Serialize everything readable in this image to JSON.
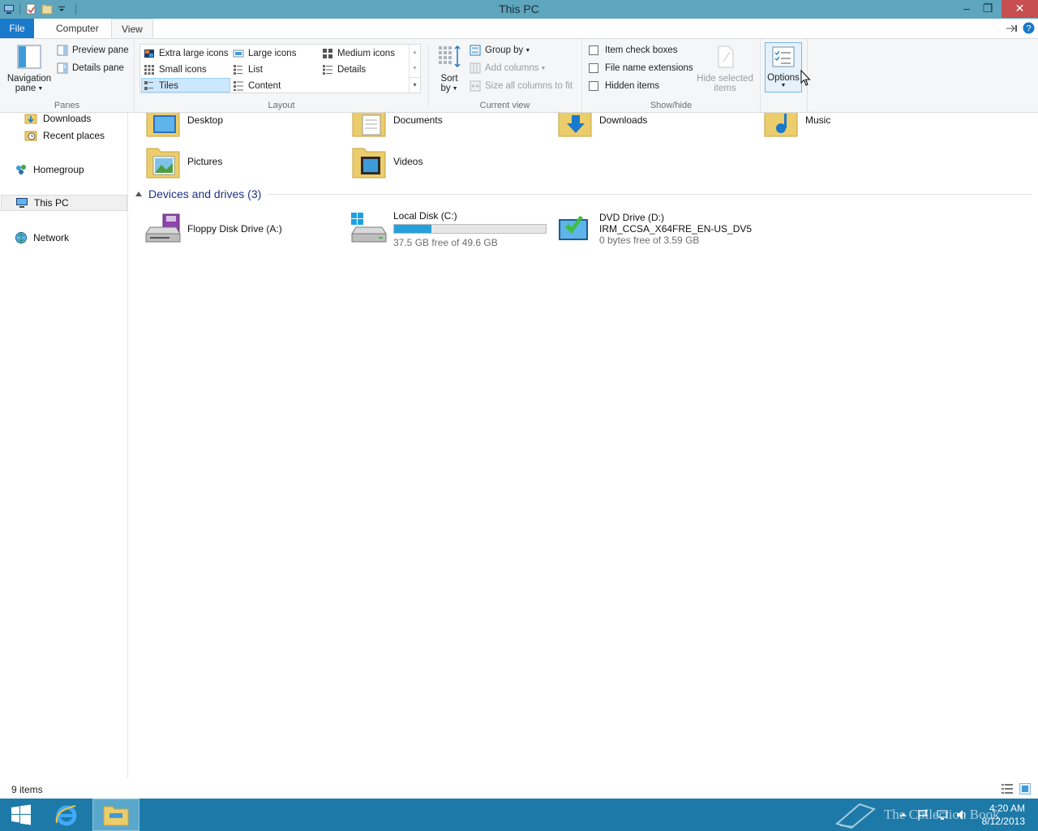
{
  "window": {
    "title": "This PC",
    "controls": {
      "minimize": "–",
      "maximize": "❐",
      "close": "✕"
    }
  },
  "ribbon_tabs": {
    "file": "File",
    "computer": "Computer",
    "view": "View"
  },
  "ribbon": {
    "panes": {
      "label": "Panes",
      "navigation_pane_line1": "Navigation",
      "navigation_pane_line2": "pane",
      "preview_pane": "Preview pane",
      "details_pane": "Details pane"
    },
    "layout": {
      "label": "Layout",
      "extra_large_icons": "Extra large icons",
      "large_icons": "Large icons",
      "medium_icons": "Medium icons",
      "small_icons": "Small icons",
      "list": "List",
      "details": "Details",
      "tiles": "Tiles",
      "content": "Content",
      "selected": "Tiles"
    },
    "current_view": {
      "label": "Current view",
      "sort_by_line1": "Sort",
      "sort_by_line2": "by",
      "group_by": "Group by",
      "add_columns": "Add columns",
      "size_all_columns": "Size all columns to fit"
    },
    "show_hide": {
      "label": "Show/hide",
      "item_check_boxes": "Item check boxes",
      "file_name_extensions": "File name extensions",
      "hidden_items": "Hidden items",
      "hide_selected_line1": "Hide selected",
      "hide_selected_line2": "items",
      "item_check_boxes_checked": false,
      "file_name_extensions_checked": false,
      "hidden_items_checked": false
    },
    "options": {
      "label": "Options"
    }
  },
  "nav_pane": {
    "items": [
      {
        "label": "Downloads",
        "icon": "downloads-folder-icon"
      },
      {
        "label": "Recent places",
        "icon": "recent-places-icon"
      },
      {
        "label": "Homegroup",
        "icon": "homegroup-icon"
      },
      {
        "label": "This PC",
        "icon": "computer-icon",
        "selected": true
      },
      {
        "label": "Network",
        "icon": "network-icon"
      }
    ]
  },
  "folders": [
    {
      "label": "Desktop",
      "icon": "desktop-folder-icon"
    },
    {
      "label": "Documents",
      "icon": "documents-folder-icon"
    },
    {
      "label": "Downloads",
      "icon": "downloads-folder-icon"
    },
    {
      "label": "Music",
      "icon": "music-folder-icon"
    },
    {
      "label": "Pictures",
      "icon": "pictures-folder-icon"
    },
    {
      "label": "Videos",
      "icon": "videos-folder-icon"
    }
  ],
  "devices": {
    "header": "Devices and drives (3)",
    "items": [
      {
        "label": "Floppy Disk Drive (A:)",
        "icon": "floppy-drive-icon"
      },
      {
        "label": "Local Disk (C:)",
        "sub": "37.5 GB free of 49.6 GB",
        "used_fraction": 0.244,
        "icon": "local-disk-icon"
      },
      {
        "label": "DVD Drive (D:)",
        "volume": "IRM_CCSA_X64FRE_EN-US_DV5",
        "sub": "0 bytes free of 3.59 GB",
        "icon": "dvd-drive-icon"
      }
    ]
  },
  "status": {
    "item_count": "9 items"
  },
  "taskbar": {
    "time": "4:20 AM",
    "date": "8/12/2013",
    "watermark": "The Collection Book"
  },
  "colors": {
    "title_bar": "#5ea5be",
    "file_tab": "#1979ca",
    "taskbar": "#1d7aa8",
    "progress_fill": "#26a0da",
    "section_header": "#1e3287"
  }
}
